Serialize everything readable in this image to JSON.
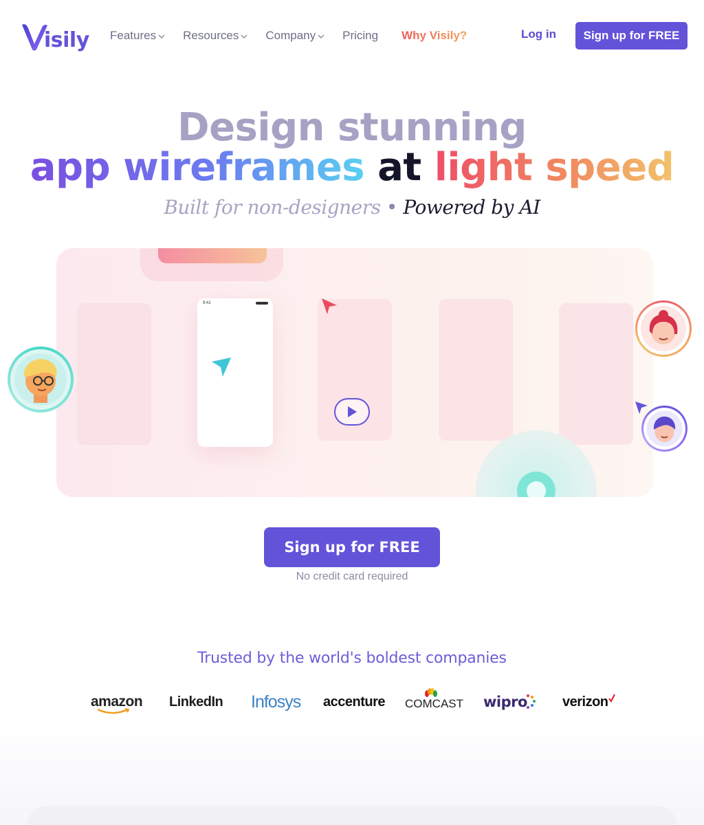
{
  "nav": {
    "logo_text": "isily",
    "items": [
      {
        "label": "Features",
        "has_dropdown": true
      },
      {
        "label": "Resources",
        "has_dropdown": true
      },
      {
        "label": "Company",
        "has_dropdown": true
      },
      {
        "label": "Pricing",
        "has_dropdown": false
      }
    ],
    "why_label": "Why Visily?",
    "login_label": "Log in",
    "signup_label": "Sign up for FREE"
  },
  "hero": {
    "line1": "Design stunning",
    "line2_part1": "app wireframes",
    "line2_part2": "at",
    "line2_part3": "light speed",
    "sub_part1": "Built for non-designers",
    "sub_sep": "•",
    "sub_part2": "Powered by AI"
  },
  "video": {
    "phone_time": "9:41",
    "play_icon": "play-icon"
  },
  "cta": {
    "label": "Sign up for FREE",
    "note": "No credit card required"
  },
  "trust": {
    "heading": "Trusted by the world's boldest companies",
    "brands": [
      "amazon",
      "LinkedIn",
      "Infosys",
      "accenture",
      "COMCAST",
      "wipro",
      "verizon"
    ]
  },
  "colors": {
    "brand": "#6353d9",
    "accent_warm": "#f0614f",
    "heading_muted": "#a6a2c4"
  }
}
